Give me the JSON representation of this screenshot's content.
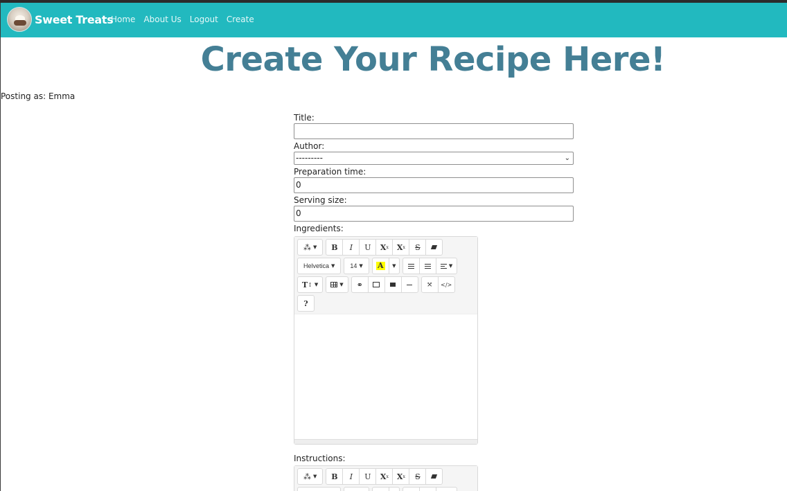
{
  "nav": {
    "brand": "Sweet Treats",
    "links": [
      "Home",
      "About Us",
      "Logout",
      "Create"
    ]
  },
  "page": {
    "title": "Create Your Recipe Here!",
    "posting_as": "Posting as: Emma"
  },
  "form": {
    "title_label": "Title:",
    "title_value": "",
    "author_label": "Author:",
    "author_selected": "---------",
    "prep_label": "Preparation time:",
    "prep_value": "0",
    "serving_label": "Serving size:",
    "serving_value": "0",
    "ingredients_label": "Ingredients:",
    "instructions_label": "Instructions:"
  },
  "toolbar": {
    "font_name": "Helvetica",
    "font_size": "14",
    "bold": "B",
    "italic": "I",
    "underline": "U",
    "superscript": "X",
    "subscript": "X",
    "strikethrough": "S",
    "color_letter": "A",
    "help": "?"
  },
  "colors": {
    "navbar": "#22b9bf",
    "title": "#447f95",
    "highlight": "#ffff00"
  }
}
